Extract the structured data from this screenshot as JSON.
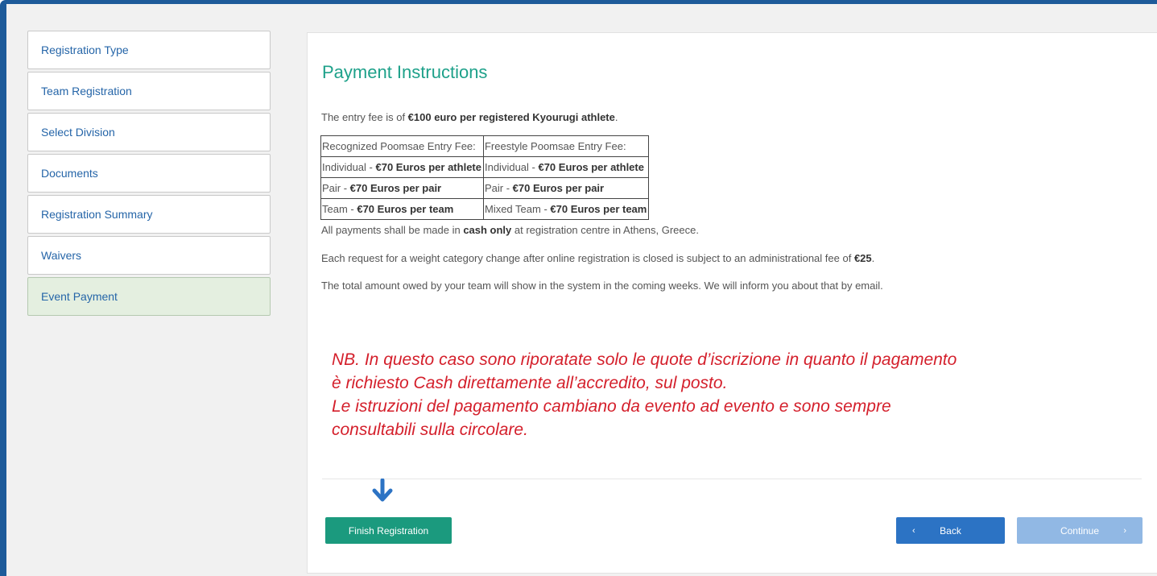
{
  "sidebar": {
    "items": [
      {
        "label": "Registration Type"
      },
      {
        "label": "Team Registration"
      },
      {
        "label": "Select Division"
      },
      {
        "label": "Documents"
      },
      {
        "label": "Registration Summary"
      },
      {
        "label": "Waivers"
      },
      {
        "label": "Event Payment"
      }
    ]
  },
  "main": {
    "title": "Payment Instructions",
    "intro": {
      "pre": "The entry fee is of ",
      "bold": "€100 euro per registered Kyourugi athlete",
      "post": "."
    },
    "fees_table": {
      "rows": [
        [
          {
            "text": "Recognized Poomsae Entry Fee:",
            "bold": ""
          },
          {
            "text": "Freestyle Poomsae Entry Fee:",
            "bold": ""
          }
        ],
        [
          {
            "text": "Individual - ",
            "bold": "€70 Euros per athlete"
          },
          {
            "text": "Individual - ",
            "bold": "€70 Euros per athlete"
          }
        ],
        [
          {
            "text": "Pair - ",
            "bold": "€70 Euros per pair"
          },
          {
            "text": "Pair - ",
            "bold": "€70 Euros per pair"
          }
        ],
        [
          {
            "text": "Team - ",
            "bold": "€70 Euros per team"
          },
          {
            "text": "Mixed Team - ",
            "bold": "€70 Euros per team"
          }
        ]
      ]
    },
    "payment_note": {
      "pre": "All payments shall be made in ",
      "bold": "cash only",
      "post": " at registration centre in Athens, Greece."
    },
    "weight_note": {
      "pre": "Each request for a weight category change after online registration is closed is subject to an administrational fee of ",
      "bold": "€25",
      "post": "."
    },
    "total_note": "The total amount owed by your team will show in the system in the coming weeks. We will inform you about that by email.",
    "annotation_lines": [
      "NB. In questo caso sono riporatate solo le quote d’iscrizione in quanto il pagamento",
      "è richiesto Cash direttamente all’accredito, sul posto.",
      "Le istruzioni del pagamento cambiano da evento ad evento e sono sempre",
      "consultabili sulla circolare."
    ]
  },
  "buttons": {
    "finish": "Finish Registration",
    "back": "Back",
    "continue": "Continue",
    "back_chevron": "‹",
    "continue_chevron": "›"
  },
  "colors": {
    "frame": "#1e5b9a",
    "title": "#1ea18a",
    "link": "#2565a8",
    "annotation": "#d41f2b",
    "arrow": "#2c73c4",
    "finish_button": "#1b9a7e",
    "back_button": "#2c73c4",
    "continue_button": "#91b8e4"
  },
  "icons": {
    "annotation_arrow": "arrow-down-icon",
    "back": "chevron-left-icon",
    "continue": "chevron-right-icon"
  }
}
